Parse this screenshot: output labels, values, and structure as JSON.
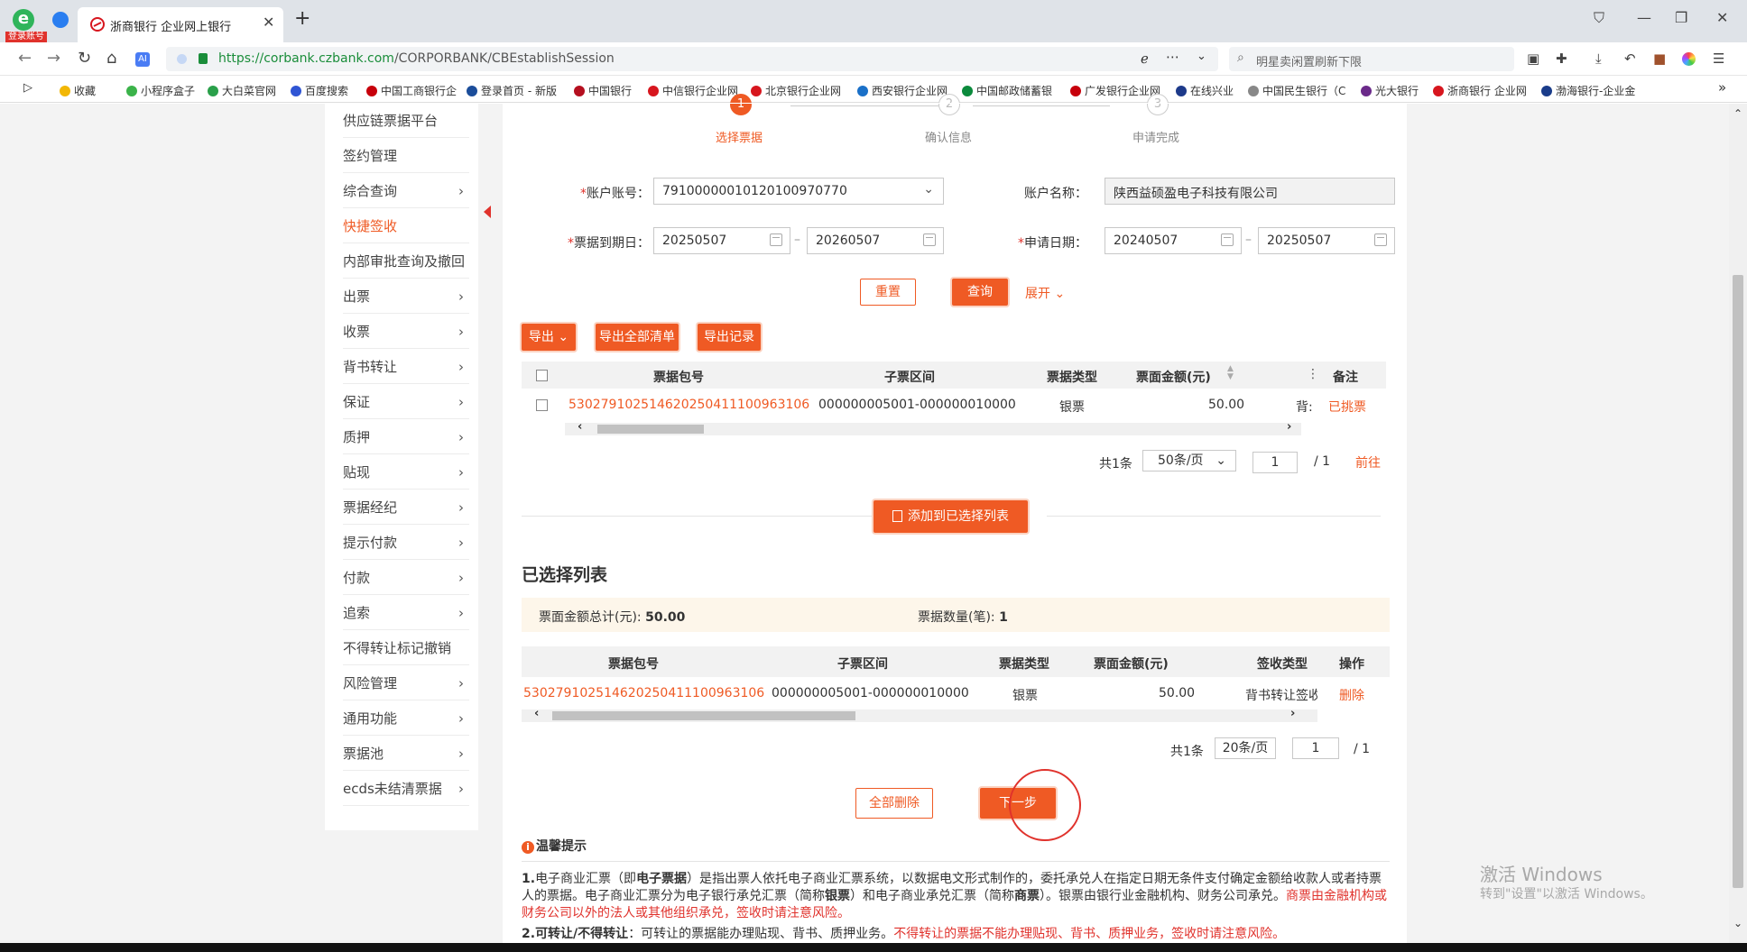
{
  "browser": {
    "tab_title": "浙商银行 企业网上银行",
    "login_badge": "登录账号",
    "url_prefix": "https://",
    "url_host": "corbank.czbank.com",
    "url_path": "/CORPORBANK/CBEstablishSession",
    "search_placeholder": "明星卖闲置刷新下限",
    "bookmarks": [
      {
        "label": "收藏",
        "color": "#f2b705"
      },
      {
        "label": "小程序盒子",
        "color": "#3bb34a"
      },
      {
        "label": "大白菜官网",
        "color": "#2aa04a"
      },
      {
        "label": "百度搜索",
        "color": "#2f55d4"
      },
      {
        "label": "中国工商银行企",
        "color": "#c7000b"
      },
      {
        "label": "登录首页 - 新版",
        "color": "#1b4d9a"
      },
      {
        "label": "中国银行",
        "color": "#b50f1f"
      },
      {
        "label": "中信银行企业网",
        "color": "#d7161e"
      },
      {
        "label": "北京银行企业网",
        "color": "#d7161e"
      },
      {
        "label": "西安银行企业网",
        "color": "#1a70c8"
      },
      {
        "label": "中国邮政储蓄银",
        "color": "#0b8a3c"
      },
      {
        "label": "广发银行企业网",
        "color": "#c7000b"
      },
      {
        "label": "在线兴业",
        "color": "#1d3a8a"
      },
      {
        "label": "中国民生银行（C",
        "color": "#888888"
      },
      {
        "label": "光大银行",
        "color": "#6b2a8a"
      },
      {
        "label": "浙商银行 企业网",
        "color": "#d7161e"
      },
      {
        "label": "渤海银行-企业金",
        "color": "#1a3c8a"
      }
    ]
  },
  "sidebar": {
    "items": [
      {
        "label": "供应链票据平台",
        "has_arrow": false
      },
      {
        "label": "签约管理",
        "has_arrow": false
      },
      {
        "label": "综合查询",
        "has_arrow": true
      },
      {
        "label": "快捷签收",
        "has_arrow": false,
        "active": true
      },
      {
        "label": "内部审批查询及撤回",
        "has_arrow": false
      },
      {
        "label": "出票",
        "has_arrow": true
      },
      {
        "label": "收票",
        "has_arrow": true
      },
      {
        "label": "背书转让",
        "has_arrow": true
      },
      {
        "label": "保证",
        "has_arrow": true
      },
      {
        "label": "质押",
        "has_arrow": true
      },
      {
        "label": "贴现",
        "has_arrow": true
      },
      {
        "label": "票据经纪",
        "has_arrow": true
      },
      {
        "label": "提示付款",
        "has_arrow": true
      },
      {
        "label": "付款",
        "has_arrow": true
      },
      {
        "label": "追索",
        "has_arrow": true
      },
      {
        "label": "不得转让标记撤销",
        "has_arrow": false
      },
      {
        "label": "风险管理",
        "has_arrow": true
      },
      {
        "label": "通用功能",
        "has_arrow": true
      },
      {
        "label": "票据池",
        "has_arrow": true
      },
      {
        "label": "ecds未结清票据",
        "has_arrow": true
      }
    ]
  },
  "steps": [
    {
      "number": "1",
      "label": "选择票据",
      "active": true
    },
    {
      "number": "2",
      "label": "确认信息",
      "active": false
    },
    {
      "number": "3",
      "label": "申请完成",
      "active": false
    }
  ],
  "form": {
    "account_no_label": "账户账号：",
    "account_no_value": "791000000101201009707 70",
    "account_name_label": "账户名称：",
    "account_name_value": "陕西益硕盈电子科技有限公司",
    "due_date_label": "票据到期日：",
    "due_date_from": "20250507",
    "due_date_to": "20260507",
    "apply_date_label": "申请日期：",
    "apply_date_from": "20240507",
    "apply_date_to": "20250507",
    "reset_label": "重置",
    "query_label": "查询",
    "expand_label": "展开"
  },
  "toolbar": {
    "export_label": "导出",
    "export_all_label": "导出全部清单",
    "export_record_label": "导出记录"
  },
  "table1": {
    "headers": [
      "票据包号",
      "子票区间",
      "票据类型",
      "票面金额(元)",
      "备注"
    ],
    "rows": [
      {
        "bill_no": "530279102514620250411100963106",
        "range": "000000005001-000000010000",
        "type": "银票",
        "amount": "50.00",
        "extra": "背:",
        "remark": "已挑票"
      }
    ]
  },
  "pager1": {
    "total": "共1条",
    "page_size": "50条/页",
    "page": "1",
    "total_pages": "/ 1",
    "go_label": "前往"
  },
  "add_button_label": "添加到已选择列表",
  "selected": {
    "title": "已选择列表",
    "sum_label": "票面金额总计(元):",
    "sum_value": "50.00",
    "count_label": "票据数量(笔):",
    "count_value": "1"
  },
  "table2": {
    "headers": [
      "票据包号",
      "子票区间",
      "票据类型",
      "票面金额(元)",
      "签收类型",
      "操作"
    ],
    "rows": [
      {
        "bill_no": "530279102514620250411100963106",
        "range": "000000005001-000000010000",
        "type": "银票",
        "amount": "50.00",
        "sign_type": "背书转让签收",
        "action": "删除"
      }
    ]
  },
  "pager2": {
    "total": "共1条",
    "page_size": "20条/页",
    "page": "1",
    "total_pages": "/ 1"
  },
  "actions": {
    "delete_all_label": "全部删除",
    "next_label": "下一步"
  },
  "tips": {
    "title": "温馨提示",
    "p1_num": "1.",
    "p1_a": "电子商业汇票（即",
    "p1_b": "电子票据",
    "p1_c": "）是指出票人依托电子商业汇票系统，以数据电文形式制作的，委托承兑人在指定日期无条件支付确定金额给收款人或者持票人的票据。电子商业汇票分为电子银行承兑汇票（简称",
    "p1_d": "银票",
    "p1_e": "）和电子商业承兑汇票（简称",
    "p1_f": "商票",
    "p1_g": "）。银票由银行业金融机构、财务公司承兑。",
    "p1_warn": "商票由金融机构或财务公司以外的法人或其他组织承兑，签收时请注意风险。",
    "p2_num": "2.",
    "p2_a": "可转让/不得转让",
    "p2_b": "：可转让的票据能办理贴现、背书、质押业务。",
    "p2_warn": "不得转让的票据不能办理贴现、背书、质押业务，签收时请注意风险。"
  },
  "watermark": {
    "line1": "激活 Windows",
    "line2": "转到\"设置\"以激活 Windows。"
  },
  "colors": {
    "accent": "#ef5a24",
    "danger": "#e0322c"
  }
}
